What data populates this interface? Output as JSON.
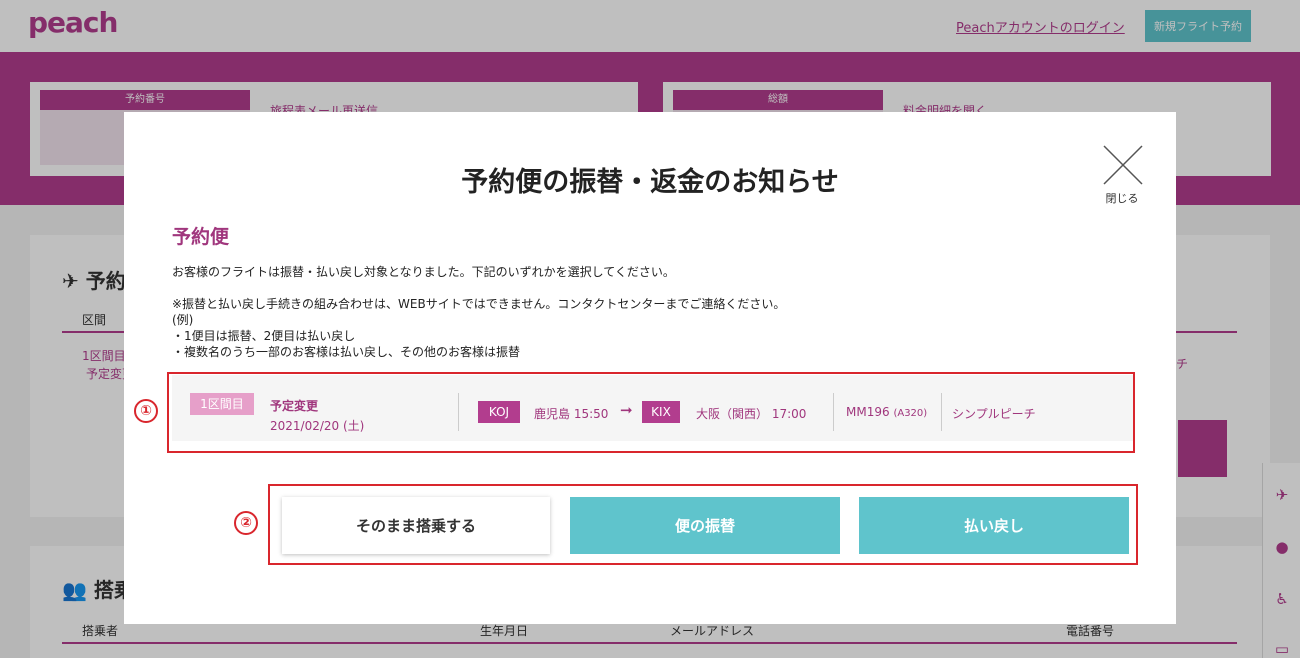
{
  "header": {
    "logo": "peach",
    "login_link": "Peachアカウントのログイン",
    "new_booking": "新規フライト予約"
  },
  "summary": {
    "booking_label": "予約番号",
    "booking_action": "旅程表メール再送信",
    "total_label": "総額",
    "total_action": "料金明細を開く"
  },
  "background": {
    "flights_title": "予約便",
    "col_segment": "区間",
    "seg_row": "1区間目",
    "seg_sub": "予定変更",
    "right_fragment": "チ",
    "passengers_title": "搭乗者",
    "cols": [
      "搭乗者",
      "生年月日",
      "メールアドレス",
      "電話番号"
    ]
  },
  "modal": {
    "title": "予約便の振替・返金のお知らせ",
    "close_label": "閉じる",
    "section_head": "予約便",
    "desc1": "お客様のフライトは振替・払い戻し対象となりました。下記のいずれかを選択してください。",
    "desc2": "※振替と払い戻し手続きの組み合わせは、WEBサイトではできません。コンタクトセンターまでご連絡ください。",
    "desc3": "(例)",
    "desc4": "・1便目は振替、2便目は払い戻し",
    "desc5": "・複数名のうち一部のお客様は払い戻し、その他のお客様は振替",
    "flight": {
      "segment": "1区間目",
      "status": "予定変更",
      "date": "2021/02/20 (土)",
      "from_code": "KOJ",
      "from_text": "鹿児島 15:50",
      "arrow": "➞",
      "to_code": "KIX",
      "to_text": "大阪（関西） 17:00",
      "flight_no": "MM196",
      "aircraft": "(A320)",
      "fare": "シンプルピーチ"
    },
    "buttons": {
      "keep": "そのまま搭乗する",
      "change": "便の振替",
      "refund": "払い戻し"
    }
  },
  "markers": [
    "①",
    "②"
  ],
  "colors": {
    "brand": "#b23d8e",
    "accent": "#5fc4cc",
    "highlight": "#d9262d"
  }
}
